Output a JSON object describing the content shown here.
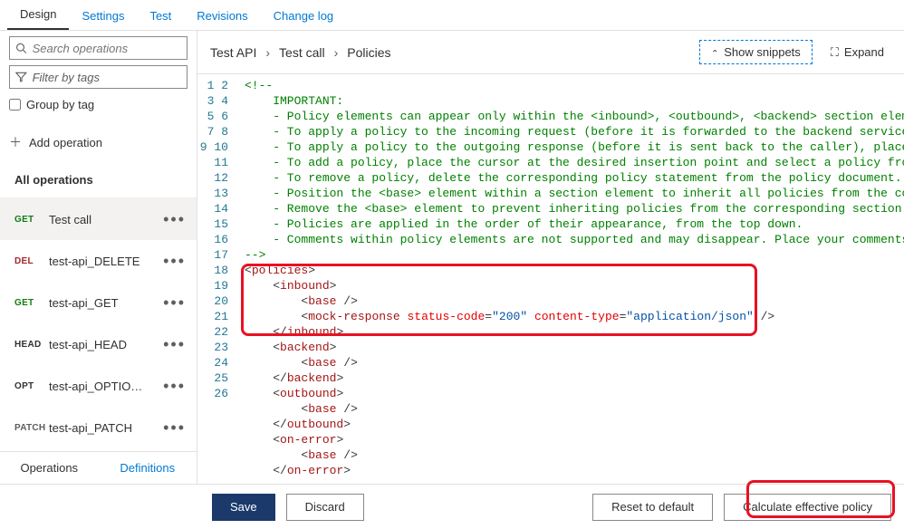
{
  "tabs": {
    "design": "Design",
    "settings": "Settings",
    "test": "Test",
    "revisions": "Revisions",
    "changelog": "Change log"
  },
  "sidebar": {
    "search_placeholder": "Search operations",
    "filter_placeholder": "Filter by tags",
    "group_label": "Group by tag",
    "add_op": "Add operation",
    "all_ops": "All operations",
    "items": [
      {
        "method": "GET",
        "label": "Test call"
      },
      {
        "method": "DEL",
        "label": "test-api_DELETE"
      },
      {
        "method": "GET",
        "label": "test-api_GET"
      },
      {
        "method": "HEAD",
        "label": "test-api_HEAD"
      },
      {
        "method": "OPT",
        "label": "test-api_OPTIO…"
      },
      {
        "method": "PATCH",
        "label": "test-api_PATCH"
      }
    ],
    "bottom": {
      "ops": "Operations",
      "defs": "Definitions"
    }
  },
  "breadcrumbs": {
    "a": "Test API",
    "b": "Test call",
    "c": "Policies"
  },
  "actions": {
    "snippets": "Show snippets",
    "expand": "Expand"
  },
  "footer": {
    "save": "Save",
    "discard": "Discard",
    "reset": "Reset to default",
    "calc": "Calculate effective policy"
  },
  "code": {
    "l1": "<!--",
    "l2": "    IMPORTANT:",
    "l3": "    - Policy elements can appear only within the <inbound>, <outbound>, <backend> section eleme",
    "l4": "    - To apply a policy to the incoming request (before it is forwarded to the backend service)",
    "l5": "    - To apply a policy to the outgoing response (before it is sent back to the caller), place ",
    "l6": "    - To add a policy, place the cursor at the desired insertion point and select a policy from",
    "l7": "    - To remove a policy, delete the corresponding policy statement from the policy document.",
    "l8": "    - Position the <base> element within a section element to inherit all policies from the cor",
    "l9": "    - Remove the <base> element to prevent inheriting policies from the corresponding section e",
    "l10": "    - Policies are applied in the order of their appearance, from the top down.",
    "l11": "    - Comments within policy elements are not supported and may disappear. Place your comments ",
    "l12": "-->",
    "status": "\"200\"",
    "ctype": "\"application/json\""
  }
}
